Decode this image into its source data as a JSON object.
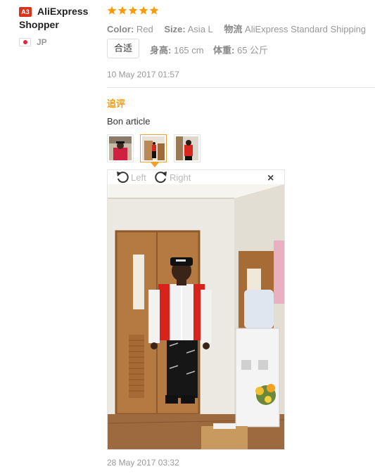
{
  "reviewer": {
    "level_badge": "A3",
    "name_line1": "AliExpress",
    "name_line2": "Shopper",
    "country_code": "JP"
  },
  "review": {
    "rating": 5,
    "attributes": [
      {
        "label": "Color:",
        "value": "Red"
      },
      {
        "label": "Size:",
        "value": "Asia L"
      },
      {
        "label": "物流",
        "value": "AliExpress Standard Shipping"
      }
    ],
    "fit": "合适",
    "height_label": "身高:",
    "height_value": "165 cm",
    "weight_label": "体重:",
    "weight_value": "65 公斤",
    "date": "10 May 2017 01:57"
  },
  "followup": {
    "title": "追评",
    "text": "Bon article",
    "thumbnail_count": 3,
    "active_thumbnail": 2,
    "viewer": {
      "rotate_left_label": "Left",
      "rotate_right_label": "Right",
      "close_label": "×"
    },
    "date": "28 May 2017 03:32"
  },
  "colors": {
    "star": "#ff9a00",
    "followup_title": "#ff9900",
    "level_badge": "#d9331c"
  }
}
